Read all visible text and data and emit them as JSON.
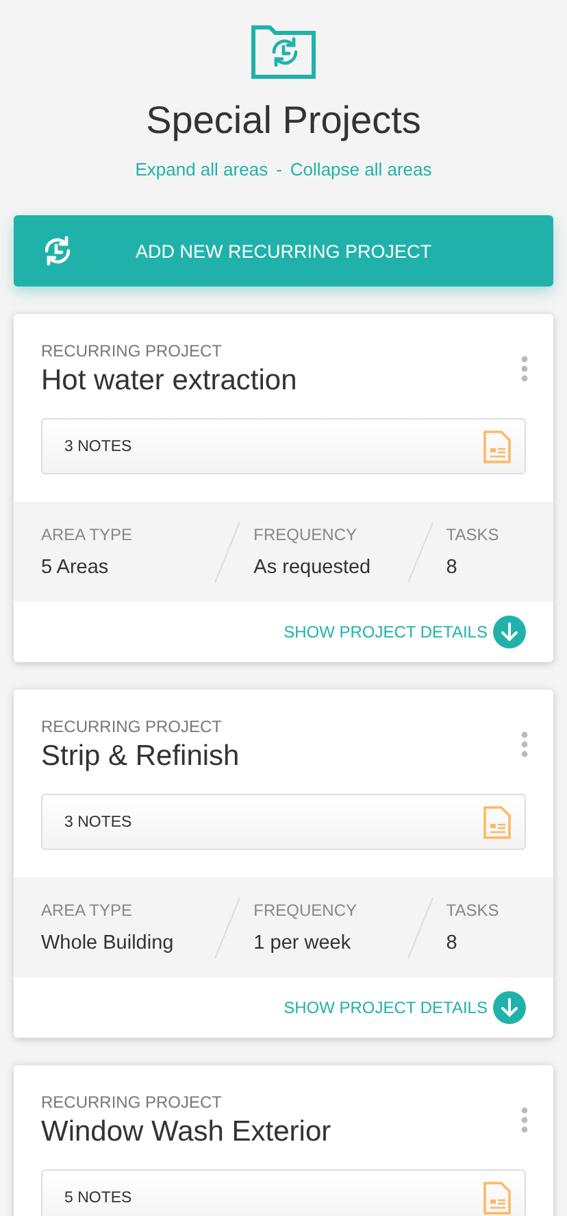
{
  "header": {
    "title": "Special Projects",
    "links": [
      {
        "label": "Expand all areas"
      },
      {
        "label": "Collapse all areas"
      }
    ],
    "separator": "-"
  },
  "add_button": {
    "label": "ADD NEW RECURRING PROJECT"
  },
  "projects": [
    {
      "label": "RECURRING PROJECT",
      "title": "Hot water extraction",
      "notes": "3 NOTES",
      "stats": [
        {
          "label": "AREA TYPE",
          "value": "5 Areas"
        },
        {
          "label": "FREQUENCY",
          "value": "As requested"
        },
        {
          "label": "TASKS",
          "value": "8"
        }
      ],
      "details_link": "SHOW PROJECT DETAILS"
    },
    {
      "label": "RECURRING PROJECT",
      "title": "Strip & Refinish",
      "notes": "3 NOTES",
      "stats": [
        {
          "label": "AREA TYPE",
          "value": "Whole Building"
        },
        {
          "label": "FREQUENCY",
          "value": "1 per week"
        },
        {
          "label": "TASKS",
          "value": "8"
        }
      ],
      "details_link": "SHOW PROJECT DETAILS"
    },
    {
      "label": "RECURRING PROJECT",
      "title": "Window Wash Exterior",
      "notes": "5 NOTES"
    }
  ]
}
